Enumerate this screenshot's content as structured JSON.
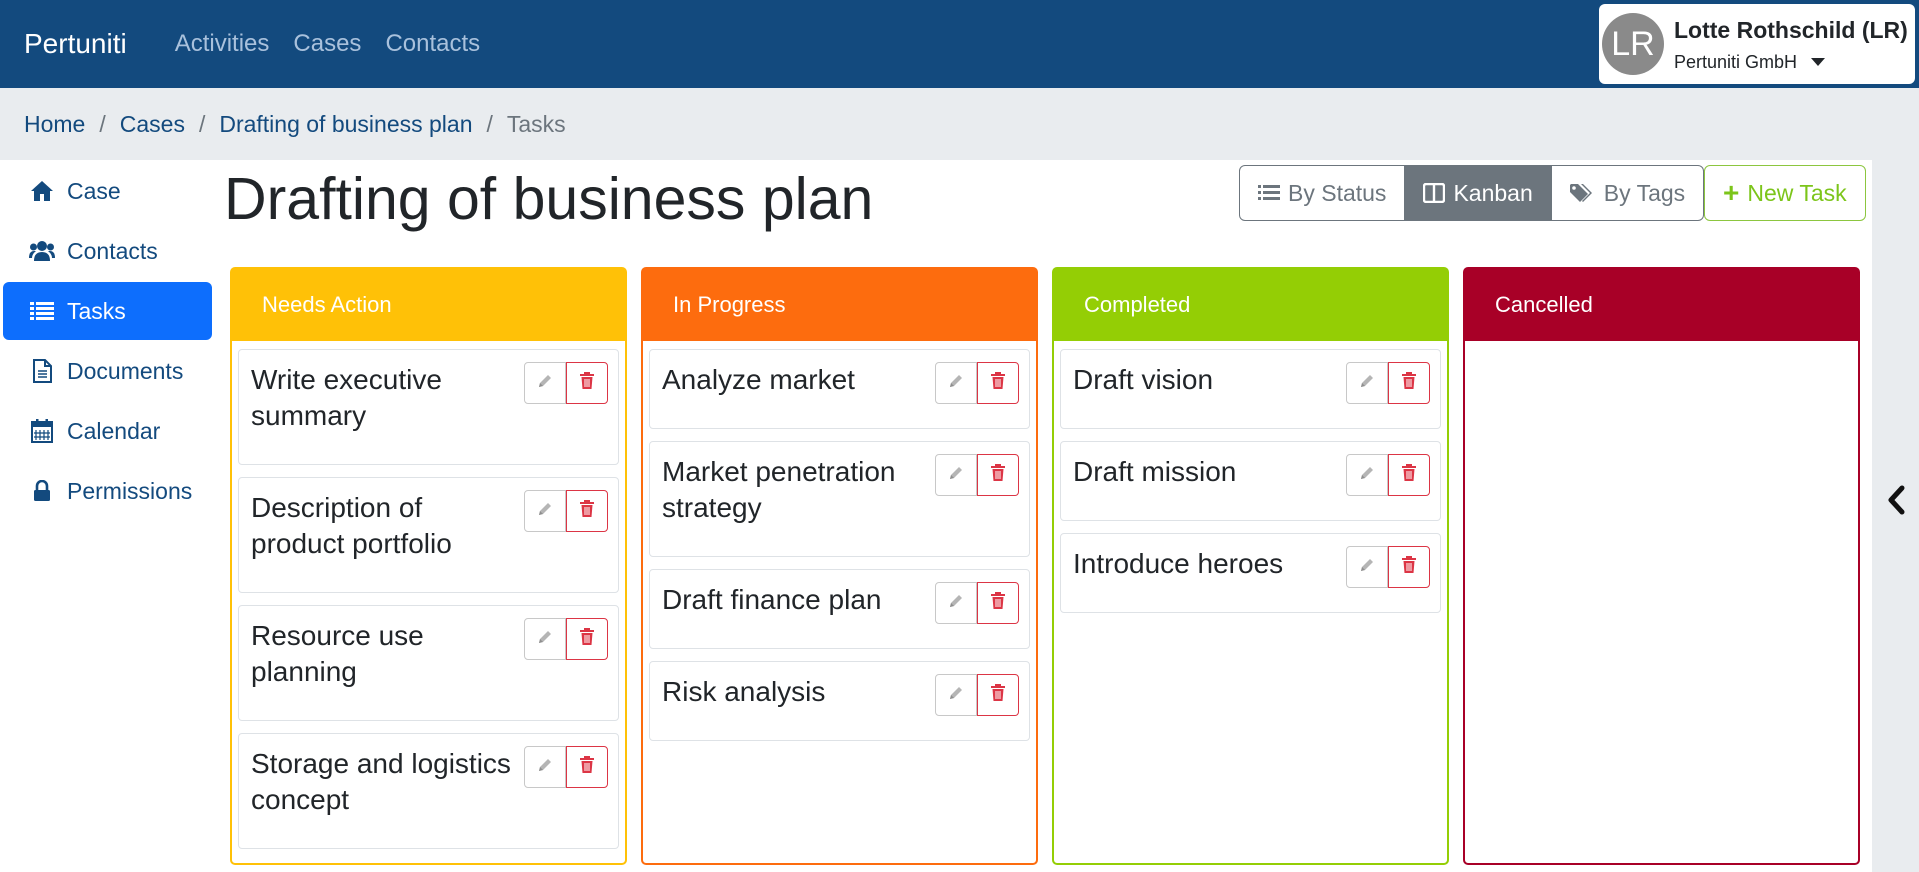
{
  "navbar": {
    "brand": "Pertuniti",
    "links": [
      "Activities",
      "Cases",
      "Contacts"
    ],
    "user": {
      "initials": "LR",
      "name": "Lotte Rothschild (LR)",
      "org": "Pertuniti GmbH"
    }
  },
  "breadcrumb": [
    "Home",
    "Cases",
    "Drafting of business plan",
    "Tasks"
  ],
  "breadcrumb_sep": "/",
  "sidebar": {
    "items": [
      {
        "label": "Case",
        "icon": "home-icon"
      },
      {
        "label": "Contacts",
        "icon": "users-icon"
      },
      {
        "label": "Tasks",
        "icon": "list-icon",
        "active": true
      },
      {
        "label": "Documents",
        "icon": "document-icon"
      },
      {
        "label": "Calendar",
        "icon": "calendar-icon"
      },
      {
        "label": "Permissions",
        "icon": "lock-icon"
      }
    ]
  },
  "page": {
    "title": "Drafting of business plan"
  },
  "views": {
    "by_status": "By Status",
    "kanban": "Kanban",
    "by_tags": "By Tags",
    "active": "Kanban",
    "new_task": "New Task"
  },
  "columns": [
    {
      "title": "Needs Action",
      "color": "#ffc107",
      "tasks": [
        "Write executive summary",
        "Description of product portfolio",
        "Resource use planning",
        "Storage and logistics concept"
      ]
    },
    {
      "title": "In Progress",
      "color": "#fd6c0e",
      "tasks": [
        "Analyze market",
        "Market penetration strategy",
        "Draft finance plan",
        "Risk analysis"
      ]
    },
    {
      "title": "Completed",
      "color": "#94ce05",
      "tasks": [
        "Draft vision",
        "Draft mission",
        "Introduce heroes"
      ]
    },
    {
      "title": "Cancelled",
      "color": "#a80027",
      "tasks": []
    }
  ],
  "colors": {
    "navbar": "#134a7e",
    "link": "#134a7e",
    "active": "#0d6efd",
    "danger": "#dc3545",
    "success": "#7cc51a"
  }
}
